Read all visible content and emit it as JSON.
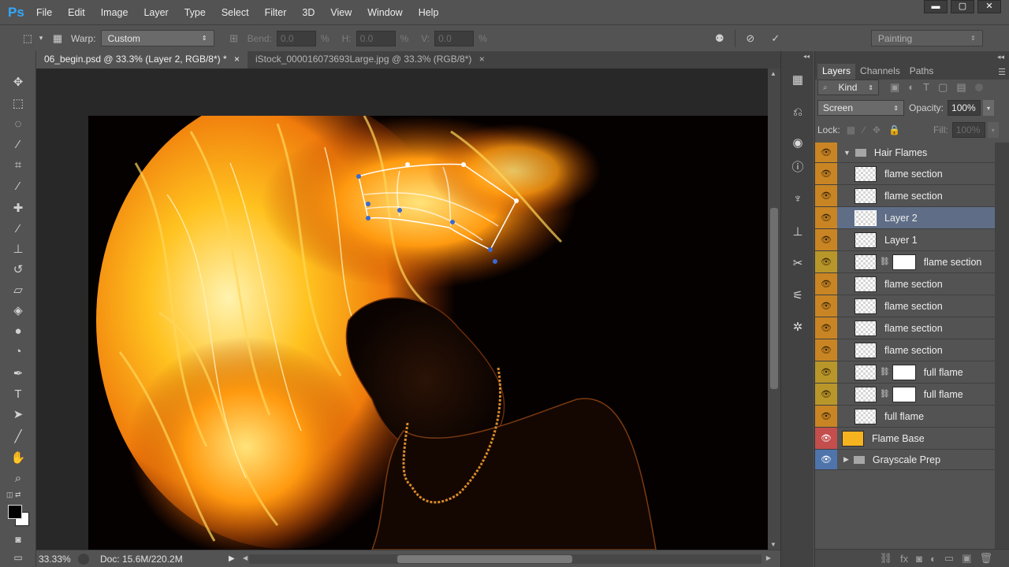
{
  "app": {
    "logo": "Ps"
  },
  "menu": [
    "File",
    "Edit",
    "Image",
    "Layer",
    "Type",
    "Select",
    "Filter",
    "3D",
    "View",
    "Window",
    "Help"
  ],
  "window_buttons": {
    "minimize": "▬",
    "maximize": "▢",
    "close": "✕"
  },
  "options": {
    "warp_label": "Warp:",
    "warp_value": "Custom",
    "bend_label": "Bend:",
    "bend_value": "0.0",
    "pct1": "%",
    "h_label": "H:",
    "h_value": "0.0",
    "pct2": "%",
    "v_label": "V:",
    "v_value": "0.0",
    "pct3": "%",
    "workspace": "Painting"
  },
  "tabs": [
    {
      "label": "06_begin.psd @ 33.3% (Layer 2, RGB/8*) *",
      "close": "×"
    },
    {
      "label": "iStock_000016073693Large.jpg @ 33.3% (RGB/8*)",
      "close": "×"
    }
  ],
  "status": {
    "zoom": "33.33%",
    "doc": "Doc: 15.6M/220.2M"
  },
  "panel": {
    "tabs": [
      "Layers",
      "Channels",
      "Paths"
    ],
    "kind_label": "Kind",
    "blend_mode": "Screen",
    "opacity_label": "Opacity:",
    "opacity_value": "100%",
    "lock_label": "Lock:",
    "fill_label": "Fill:",
    "fill_value": "100%"
  },
  "layers": [
    {
      "name": "Hair Flames"
    },
    {
      "name": "flame section"
    },
    {
      "name": "flame section"
    },
    {
      "name": "Layer 2"
    },
    {
      "name": "Layer 1"
    },
    {
      "name": "flame section"
    },
    {
      "name": "flame section"
    },
    {
      "name": "flame section"
    },
    {
      "name": "flame section"
    },
    {
      "name": "flame section"
    },
    {
      "name": "full flame"
    },
    {
      "name": "full flame"
    },
    {
      "name": "full flame"
    },
    {
      "name": "Flame Base"
    },
    {
      "name": "Grayscale Prep"
    }
  ],
  "colors": {
    "layer_orange": "#c98524",
    "layer_yellow": "#b8962a",
    "layer_red": "#c34e4c",
    "layer_blue": "#4e74ab",
    "selected_row": "#5f6e86"
  }
}
